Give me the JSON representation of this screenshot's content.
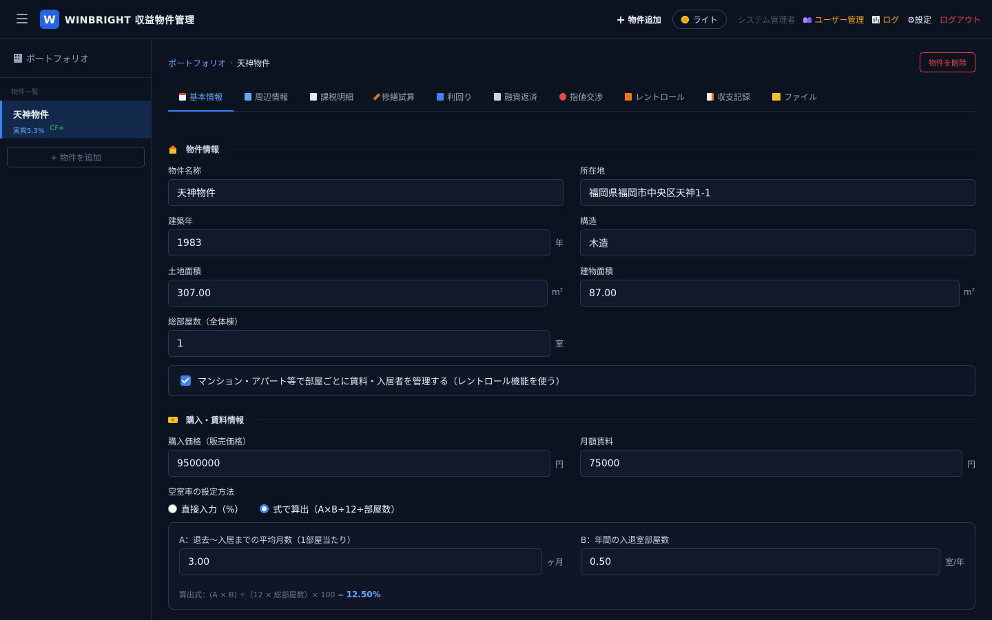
{
  "header": {
    "logo_letter": "W",
    "app_title": "WINBRIGHT 収益物件管理",
    "add_property": "物件追加",
    "theme_label": "ライト",
    "system_admin": "システム管理者",
    "user_management": "ユーザー管理",
    "log": "ログ",
    "settings": "⚙設定",
    "logout": "ログアウト"
  },
  "sidebar": {
    "title": "ポートフォリオ",
    "list_label": "物件一覧",
    "items": [
      {
        "name": "天神物件",
        "yield": "実質5.3%",
        "cf": "CF+"
      }
    ],
    "add_button": "+ 物件を追加"
  },
  "breadcrumb": {
    "root": "ポートフォリオ",
    "sep": "›",
    "current": "天神物件"
  },
  "delete_button": "物件を削除",
  "tabs": [
    {
      "label": "基本情報",
      "icon": "document-icon",
      "color": "#f1f5f9"
    },
    {
      "label": "周辺情報",
      "icon": "map-icon",
      "color": "#60a5fa"
    },
    {
      "label": "課税明細",
      "icon": "receipt-icon",
      "color": "#e2e8f0"
    },
    {
      "label": "修繕試算",
      "icon": "hammer-icon",
      "color": "#d97706"
    },
    {
      "label": "利回り",
      "icon": "chart-icon",
      "color": "#3b82f6"
    },
    {
      "label": "融資返済",
      "icon": "bank-icon",
      "color": "#cbd5e1"
    },
    {
      "label": "指値交渉",
      "icon": "target-icon",
      "color": "#ef4444"
    },
    {
      "label": "レントロール",
      "icon": "house-icon",
      "color": "#f97316"
    },
    {
      "label": "収支記録",
      "icon": "note-icon",
      "color": "#f1f5f9"
    },
    {
      "label": "ファイル",
      "icon": "folder-icon",
      "color": "#fbbf24"
    }
  ],
  "section_property": {
    "title": "物件情報",
    "name_label": "物件名称",
    "name_value": "天神物件",
    "address_label": "所在地",
    "address_value": "福岡県福岡市中央区天神1-1",
    "year_label": "建築年",
    "year_value": "1983",
    "year_unit": "年",
    "structure_label": "構造",
    "structure_value": "木造",
    "land_label": "土地面積",
    "land_value": "307.00",
    "land_unit": "m",
    "building_label": "建物面積",
    "building_value": "87.00",
    "building_unit": "m",
    "area_sup": "2",
    "rooms_label": "総部屋数（全体棟）",
    "rooms_value": "1",
    "rooms_unit": "室",
    "rentroll_checkbox": "マンション・アパート等で部屋ごとに賃料・入居者を管理する（レントロール機能を使う）"
  },
  "section_purchase": {
    "title": "購入・賃料情報",
    "price_label": "購入価格（販売価格）",
    "price_value": "9500000",
    "price_unit": "円",
    "rent_label": "月額賃料",
    "rent_value": "75000",
    "rent_unit": "円",
    "vacancy_label": "空室率の設定方法",
    "radio_direct": "直接入力（%）",
    "radio_formula": "式で算出（A×B÷12÷部屋数）",
    "a_label": "A：退去〜入居までの平均月数（1部屋当たり）",
    "a_value": "3.00",
    "a_unit": "ヶ月",
    "b_label": "B：年間の入退室部屋数",
    "b_value": "0.50",
    "b_unit": "室/年",
    "formula_text": "算出式：(A × B) ÷（12 × 総部屋数）× 100 = ",
    "formula_result": "12.50%"
  }
}
